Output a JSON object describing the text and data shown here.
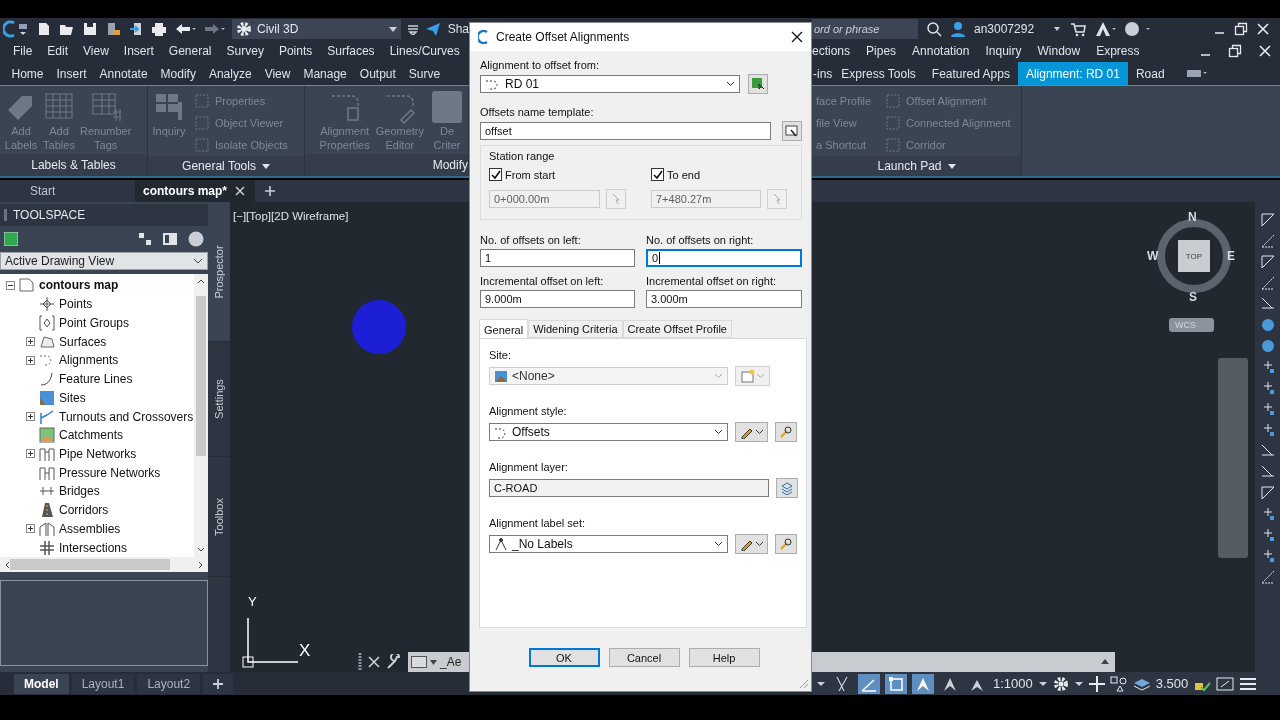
{
  "title_bar": {
    "workspace": "Civil 3D",
    "share": "Sha",
    "search": {
      "placeholder": "ord or phrase"
    },
    "user": "an3007292"
  },
  "menu_bar": {
    "left": [
      "File",
      "Edit",
      "View",
      "Insert",
      "General",
      "Survey",
      "Points",
      "Surfaces",
      "Lines/Curves"
    ],
    "right": [
      "ections",
      "Pipes",
      "Annotation",
      "Inquiry",
      "Window",
      "Express"
    ]
  },
  "ribbon_tabs": {
    "left": [
      {
        "label": "Home",
        "selected": false
      },
      {
        "label": "Insert",
        "selected": false
      },
      {
        "label": "Annotate",
        "selected": false
      },
      {
        "label": "Modify",
        "selected": false
      },
      {
        "label": "Analyze",
        "selected": false
      },
      {
        "label": "View",
        "selected": false
      },
      {
        "label": "Manage",
        "selected": false
      },
      {
        "label": "Output",
        "selected": false
      },
      {
        "label": "Surve",
        "selected": false
      }
    ],
    "right": [
      {
        "label": "-ins",
        "selected": false
      },
      {
        "label": "Express Tools",
        "selected": false
      },
      {
        "label": "Featured Apps",
        "selected": false
      },
      {
        "label": "Alignment: RD 01",
        "selected": true
      },
      {
        "label": "Road",
        "selected": false
      }
    ]
  },
  "ribbon_panels": {
    "left": [
      {
        "title": "Labels & Tables",
        "has_menu": false,
        "tools": [
          {
            "kind": "large",
            "lines": [
              "Add",
              "Labels"
            ]
          },
          {
            "kind": "large",
            "lines": [
              "Add",
              "Tables"
            ]
          },
          {
            "kind": "large",
            "lines": [
              "Renumber",
              "Tags"
            ]
          }
        ]
      },
      {
        "title": "General Tools",
        "has_menu": true,
        "tools": [
          {
            "kind": "large",
            "lines": [
              "Inquiry"
            ]
          },
          {
            "kind": "stack",
            "items": [
              "Properties",
              "Object Viewer",
              "Isolate Objects"
            ]
          }
        ]
      },
      {
        "title": "Modify",
        "has_menu": false,
        "tools": [
          {
            "kind": "large",
            "lines": [
              "Alignment",
              "Properties"
            ]
          },
          {
            "kind": "large",
            "lines": [
              "Geometry",
              "Editor"
            ]
          },
          {
            "kind": "large",
            "lines": [
              "De",
              "Criter"
            ]
          }
        ]
      }
    ],
    "right": [
      {
        "title": "Launch Pad",
        "has_menu": true,
        "tools": [
          {
            "kind": "stack",
            "items": [
              "face Profile",
              "file View",
              "a Shortcut"
            ]
          },
          {
            "kind": "stack",
            "items": [
              "Offset Alignment",
              "Connected Alignment",
              "Corridor"
            ]
          }
        ]
      }
    ]
  },
  "document_tabs": [
    {
      "label": "Start",
      "selected": false
    },
    {
      "label": "contours map*",
      "selected": true
    }
  ],
  "toolspace": {
    "title": "TOOLSPACE",
    "view": "Active Drawing View",
    "side_tabs": [
      {
        "label": "Prospector",
        "selected": true
      },
      {
        "label": "Settings",
        "selected": false
      },
      {
        "label": "Toolbox",
        "selected": false
      }
    ],
    "tree": {
      "label": "contours map",
      "expanded": true,
      "children": [
        {
          "label": "Points",
          "kind": "leaf"
        },
        {
          "label": "Point Groups",
          "kind": "leaf"
        },
        {
          "label": "Surfaces",
          "kind": "collapsed"
        },
        {
          "label": "Alignments",
          "kind": "collapsed"
        },
        {
          "label": "Feature Lines",
          "kind": "leaf"
        },
        {
          "label": "Sites",
          "kind": "leaf"
        },
        {
          "label": "Turnouts and Crossovers",
          "kind": "collapsed"
        },
        {
          "label": "Catchments",
          "kind": "leaf"
        },
        {
          "label": "Pipe Networks",
          "kind": "collapsed"
        },
        {
          "label": "Pressure Networks",
          "kind": "leaf"
        },
        {
          "label": "Bridges",
          "kind": "leaf"
        },
        {
          "label": "Corridors",
          "kind": "leaf"
        },
        {
          "label": "Assemblies",
          "kind": "collapsed"
        },
        {
          "label": "Intersections",
          "kind": "leaf"
        }
      ]
    }
  },
  "viewport": {
    "label": "[−][Top][2D Wireframe]",
    "view_cube": {
      "north": "N",
      "south": "S",
      "east": "E",
      "west": "W",
      "face": "TOP",
      "ucs": "WCS"
    },
    "ucs_icon": {
      "y": "Y",
      "x": "X"
    },
    "command_line": {
      "text": "_Ae"
    }
  },
  "layout_tabs": [
    {
      "label": "Model",
      "selected": true
    },
    {
      "label": "Layout1",
      "selected": false
    },
    {
      "label": "Layout2",
      "selected": false
    }
  ],
  "status_bar": {
    "toggles": [
      {
        "on": false
      },
      {
        "on": true
      },
      {
        "on": true
      },
      {
        "on": true
      },
      {
        "on": false
      },
      {
        "on": false
      }
    ],
    "scale": "1:1000",
    "elevation": "3.500"
  },
  "dialog": {
    "title": "Create Offset Alignments",
    "alignment": {
      "label": "Alignment to offset from:",
      "value": "RD 01"
    },
    "name_template": {
      "label": "Offsets name template:",
      "value": "offset"
    },
    "station_range": {
      "title": "Station range",
      "ends": [
        {
          "label": "From start",
          "checked": true,
          "value": "0+000.00m",
          "disabled": true
        },
        {
          "label": "To end",
          "checked": true,
          "value": "7+480.27m",
          "disabled": true
        }
      ]
    },
    "offset_fields": [
      {
        "label": "No. of offsets on left:",
        "value": "1",
        "focused": false
      },
      {
        "label": "No. of offsets on right:",
        "value": "0",
        "focused": true
      },
      {
        "label": "Incremental offset on left:",
        "value": "9.000m",
        "focused": false
      },
      {
        "label": "Incremental offset on right:",
        "value": "3.000m",
        "focused": false
      }
    ],
    "tabs": [
      {
        "label": "General",
        "selected": true
      },
      {
        "label": "Widening Criteria",
        "selected": false
      },
      {
        "label": "Create Offset Profile",
        "selected": false
      }
    ],
    "settings": [
      {
        "label": "Site:",
        "value": "<None>",
        "kind": "dropdown",
        "disabled": true
      },
      {
        "label": "Alignment style:",
        "value": "Offsets",
        "kind": "dropdown",
        "disabled": false
      },
      {
        "label": "Alignment layer:",
        "value": "C-ROAD",
        "kind": "layer",
        "disabled": false
      },
      {
        "label": "Alignment label set:",
        "value": "_No Labels",
        "kind": "dropdown",
        "disabled": false
      }
    ],
    "buttons": [
      {
        "label": "OK",
        "default": true
      },
      {
        "label": "Cancel",
        "default": false
      },
      {
        "label": "Help",
        "default": false
      }
    ]
  }
}
